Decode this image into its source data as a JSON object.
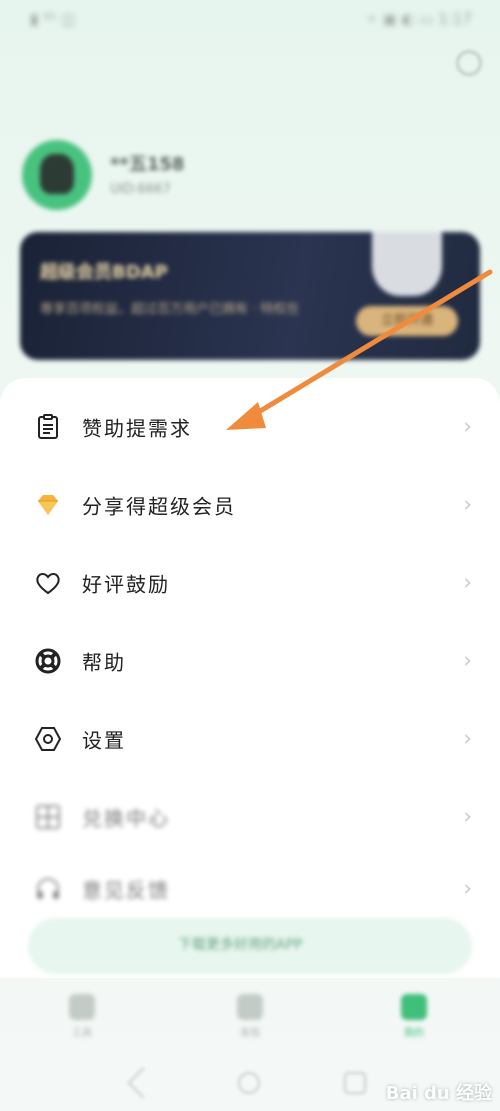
{
  "status_bar": {
    "left": "▮ ⁴ᴳ ◫",
    "right": "⚬ ▣ ◐ ▭ 1:17"
  },
  "profile": {
    "nickname": "**五158",
    "uid": "UID:6667"
  },
  "vip_card": {
    "title": "超级会员BDAP",
    "desc": "尊享百项权益，超过百万用户已拥有 · 特权在",
    "button": "立即开通"
  },
  "menu": {
    "items": [
      {
        "label": "赞助提需求",
        "icon": "clipboard-icon"
      },
      {
        "label": "分享得超级会员",
        "icon": "diamond-icon"
      },
      {
        "label": "好评鼓励",
        "icon": "heart-icon"
      },
      {
        "label": "帮助",
        "icon": "lifebuoy-icon"
      },
      {
        "label": "设置",
        "icon": "hexagon-settings-icon"
      },
      {
        "label": "兑换中心",
        "icon": "grid-icon"
      },
      {
        "label": "意见反馈",
        "icon": "headset-icon"
      }
    ]
  },
  "banner": {
    "text": "下载更多好用的APP"
  },
  "tabs": [
    {
      "label": "工具"
    },
    {
      "label": "发现"
    },
    {
      "label": "我的"
    }
  ],
  "watermark": "Bai du 经验",
  "colors": {
    "accent": "#3fbf7a",
    "arrow": "#f08a3c",
    "diamond": "#f4b33a"
  }
}
